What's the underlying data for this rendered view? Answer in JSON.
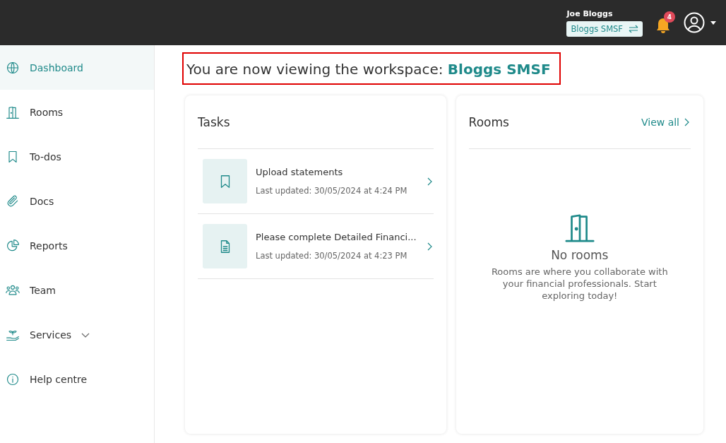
{
  "header": {
    "user_name": "Joe Bloggs",
    "workspace_button": "Bloggs SMSF",
    "notification_count": "4"
  },
  "sidebar": {
    "items": [
      {
        "label": "Dashboard",
        "kind": "globe",
        "selected": true
      },
      {
        "label": "Rooms",
        "kind": "door",
        "selected": false
      },
      {
        "label": "To-dos",
        "kind": "bookmark",
        "selected": false
      },
      {
        "label": "Docs",
        "kind": "paperclip",
        "selected": false
      },
      {
        "label": "Reports",
        "kind": "pie",
        "selected": false
      },
      {
        "label": "Team",
        "kind": "people",
        "selected": false
      },
      {
        "label": "Services",
        "kind": "plant",
        "selected": false,
        "expandable": true
      },
      {
        "label": "Help centre",
        "kind": "info",
        "selected": false
      }
    ]
  },
  "banner": {
    "text": "You are now viewing the workspace: ",
    "workspace": "Bloggs SMSF"
  },
  "tasks": {
    "title": "Tasks",
    "items": [
      {
        "title": "Upload statements",
        "updated": "Last updated: 30/05/2024 at 4:24 PM",
        "kind": "bookmark"
      },
      {
        "title": "Please complete Detailed Financi...",
        "updated": "Last updated: 30/05/2024 at 4:23 PM",
        "kind": "document"
      }
    ]
  },
  "rooms": {
    "title": "Rooms",
    "view_all": "View all",
    "empty_title": "No rooms",
    "empty_text": "Rooms are where you collaborate with your financial professionals. Start exploring today!"
  }
}
